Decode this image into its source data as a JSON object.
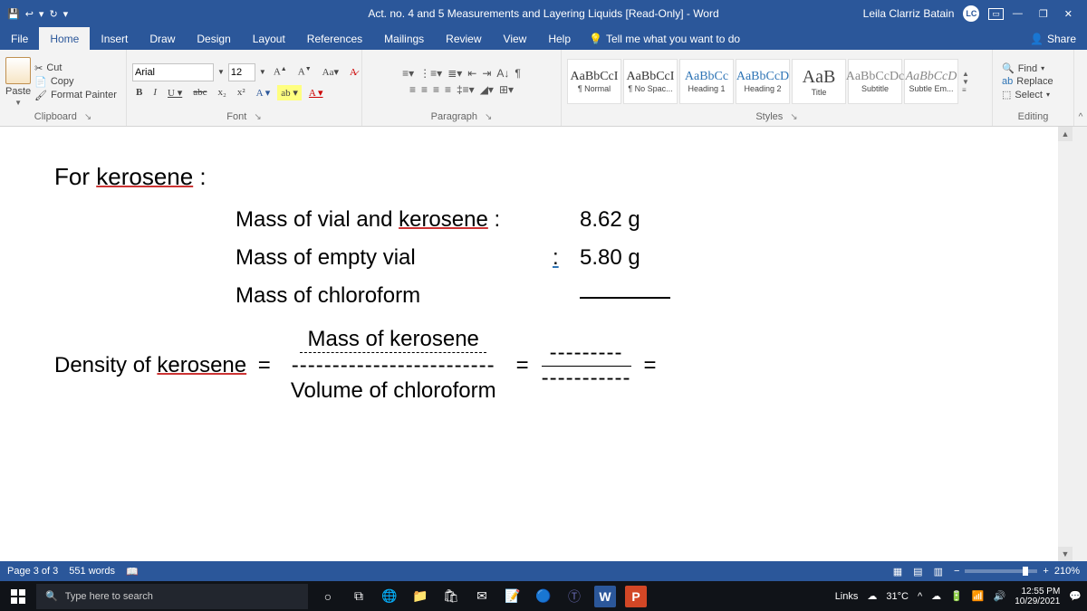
{
  "titlebar": {
    "title": "Act. no. 4 and 5  Measurements and Layering Liquids [Read-Only]  -  Word",
    "user_name": "Leila Clarriz  Batain",
    "user_initials": "LC"
  },
  "menu": {
    "file": "File",
    "home": "Home",
    "insert": "Insert",
    "draw": "Draw",
    "design": "Design",
    "layout": "Layout",
    "references": "References",
    "mailings": "Mailings",
    "review": "Review",
    "view": "View",
    "help": "Help",
    "tell_me": "Tell me what you want to do",
    "share": "Share"
  },
  "ribbon": {
    "clipboard": {
      "label": "Clipboard",
      "paste": "Paste",
      "cut": "Cut",
      "copy": "Copy",
      "format_painter": "Format Painter"
    },
    "font": {
      "label": "Font",
      "name": "Arial",
      "size": "12"
    },
    "paragraph": {
      "label": "Paragraph"
    },
    "styles": {
      "label": "Styles",
      "items": [
        {
          "preview": "AaBbCcI",
          "name": "¶ Normal"
        },
        {
          "preview": "AaBbCcI",
          "name": "¶ No Spac..."
        },
        {
          "preview": "AaBbCc",
          "name": "Heading 1"
        },
        {
          "preview": "AaBbCcD",
          "name": "Heading 2"
        },
        {
          "preview": "AaB",
          "name": "Title"
        },
        {
          "preview": "AaBbCcDc",
          "name": "Subtitle"
        },
        {
          "preview": "AaBbCcD",
          "name": "Subtle Em..."
        }
      ]
    },
    "editing": {
      "label": "Editing",
      "find": "Find",
      "replace": "Replace",
      "select": "Select"
    }
  },
  "document": {
    "heading_prefix": "For ",
    "heading_word": "kerosene",
    "heading_suffix": " :",
    "row1_prefix": "Mass of vial and ",
    "row1_word": "kerosene",
    "row1_suffix": " :",
    "row1_val": "8.62 g",
    "row2_lbl": "Mass of empty vial",
    "row2_colon": ":",
    "row2_val": "5.80 g",
    "row3_lbl": "Mass of chloroform",
    "density_prefix": "Density of ",
    "density_word": "kerosene",
    "density_eq": "=",
    "frac_num": "Mass of kerosene",
    "frac_den": "Volume of chloroform",
    "dash_line": "-------------------------",
    "dash_short1": "---------",
    "dash_short2": "-----------"
  },
  "statusbar": {
    "page": "Page 3 of 3",
    "words": "551 words",
    "zoom": "210%"
  },
  "taskbar": {
    "search_placeholder": "Type here to search",
    "links": "Links",
    "weather": "31°C",
    "time": "12:55 PM",
    "date": "10/29/2021"
  }
}
